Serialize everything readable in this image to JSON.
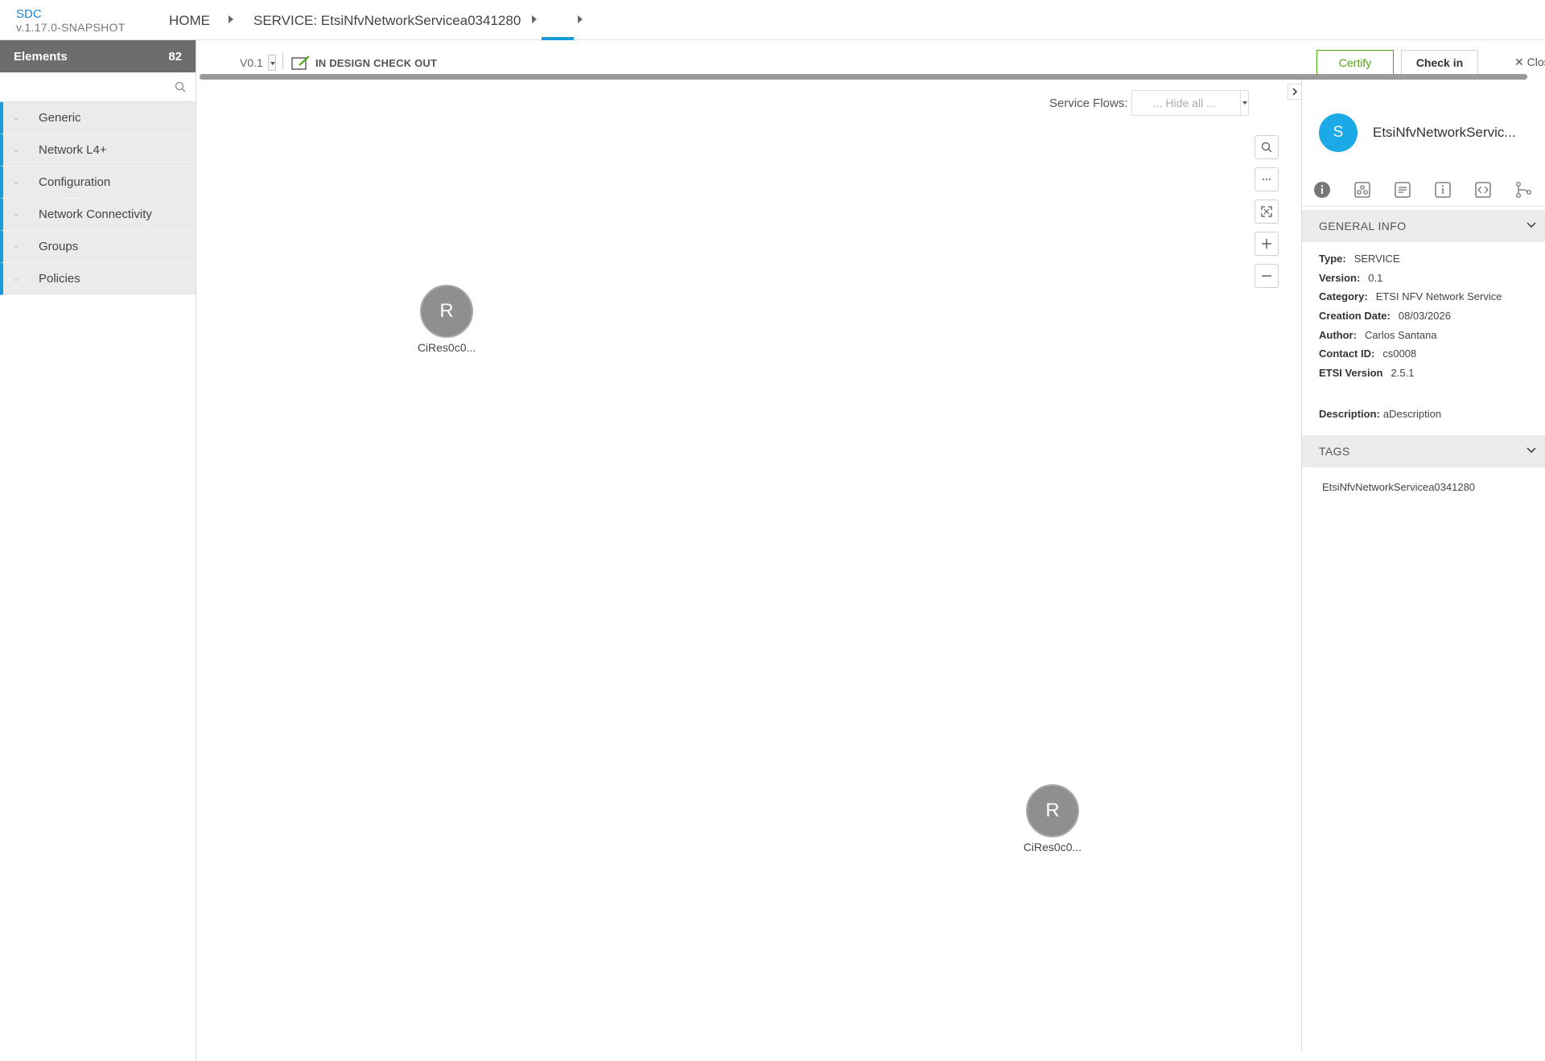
{
  "header": {
    "app_name": "SDC",
    "version": "v.1.17.0-SNAPSHOT",
    "breadcrumbs": [
      "HOME",
      "SERVICE: EtsiNfvNetworkServicea0341280",
      ""
    ]
  },
  "palette": {
    "title": "Elements",
    "count": "82",
    "search_placeholder": "",
    "categories": [
      {
        "dash": "-",
        "label": "Generic"
      },
      {
        "dash": "-",
        "label": "Network L4+"
      },
      {
        "dash": "-",
        "label": "Configuration"
      },
      {
        "dash": "-",
        "label": "Network Connectivity"
      },
      {
        "dash": "-",
        "label": "Groups"
      },
      {
        "dash": "-",
        "label": "Policies"
      }
    ]
  },
  "toolbar": {
    "version": "V0.1",
    "status": "IN DESIGN CHECK OUT",
    "certify_label": "Certify",
    "checkin_label": "Check in",
    "close_label": "Close"
  },
  "canvas": {
    "service_flows_label": "Service Flows:",
    "service_flows_value": "... Hide all ...",
    "zoom_controls": [
      "search-icon",
      "more-icon",
      "fit-icon",
      "zoom-in-icon",
      "zoom-out-icon"
    ],
    "nodes": [
      {
        "letter": "R",
        "label": "CiRes0c0..."
      },
      {
        "letter": "R",
        "label": "CiRes0c0..."
      }
    ]
  },
  "details": {
    "avatar_letter": "S",
    "title": "EtsiNfvNetworkServic...",
    "tab_icons": [
      "info-icon",
      "deployment-icon",
      "list-icon",
      "properties-icon",
      "code-icon",
      "paths-icon"
    ],
    "general_info_title": "GENERAL INFO",
    "type_label": "Type:",
    "type_value": "SERVICE",
    "version_label": "Version:",
    "version_value": "0.1",
    "category_label": "Category:",
    "category_value": "ETSI NFV Network Service",
    "creation_label": "Creation Date:",
    "creation_value": "08/03/2026",
    "author_label": "Author:",
    "author_value": "Carlos Santana",
    "contact_label": "Contact ID:",
    "contact_value": "cs0008",
    "etsi_label": "ETSI Version",
    "etsi_value": "2.5.1",
    "description_label": "Description:",
    "description_value": "aDescription",
    "tags_title": "TAGS",
    "tags": [
      "EtsiNfvNetworkServicea0341280"
    ]
  },
  "colors": {
    "accent": "#1a9cd8",
    "certify": "#4ca90c",
    "palette_header": "#6d6d6d",
    "node": "#8f8f8f",
    "avatar": "#1ba9e8"
  }
}
